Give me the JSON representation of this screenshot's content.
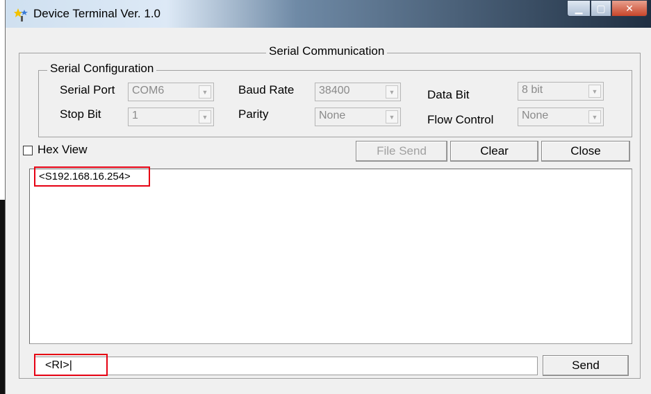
{
  "window": {
    "title": "Device Terminal Ver. 1.0"
  },
  "serial_comm": {
    "frame_title": "Serial Communication",
    "config_title": "Serial Configuration",
    "serial_port_label": "Serial Port",
    "serial_port_value": "COM6",
    "baud_rate_label": "Baud Rate",
    "baud_rate_value": "38400",
    "data_bit_label": "Data Bit",
    "data_bit_value": "8 bit",
    "stop_bit_label": "Stop Bit",
    "stop_bit_value": "1",
    "parity_label": "Parity",
    "parity_value": "None",
    "flow_control_label": "Flow Control",
    "flow_control_value": "None"
  },
  "toolbar": {
    "hex_view_label": "Hex View",
    "hex_view_checked": false,
    "file_send_label": "File Send",
    "clear_label": "Clear",
    "close_label": "Close"
  },
  "output": {
    "line1": "<S192.168.16.254>"
  },
  "input": {
    "value": "<RI>|",
    "send_label": "Send"
  }
}
